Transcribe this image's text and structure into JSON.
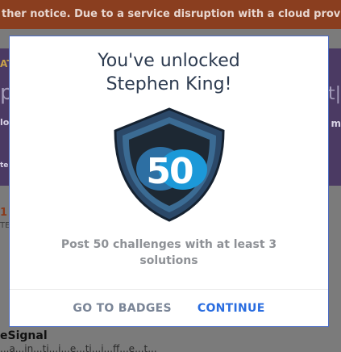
{
  "background": {
    "banner_text": "ther notice. Due to a service disruption with a cloud provid",
    "left_fragment_a": "AT",
    "left_fragment_b": "p",
    "left_fragment_c": "lo",
    "left_fragment_d": "te",
    "left_fragment_e": "1",
    "left_fragment_f": "TE",
    "right_fragment_a": "t|",
    "right_fragment_b": "m",
    "bottom_heading": "eSignal",
    "bottom_text": "...a...in...ti...i...e...ti...i...ff...e...t..."
  },
  "modal": {
    "title_line1": "You've unlocked",
    "title_line2": "Stephen King!",
    "badge_number": "50",
    "description": "Post 50 challenges with at least 3 solutions",
    "go_to_badges_label": "GO TO BADGES",
    "continue_label": "CONTINUE"
  },
  "colors": {
    "primary": "#2a6de0",
    "secondary": "#7a8597",
    "title": "#2d3b50",
    "badge_outer": "#2d4a6a",
    "badge_inner": "#1e2a36",
    "badge_blob": "#1c99d8"
  }
}
